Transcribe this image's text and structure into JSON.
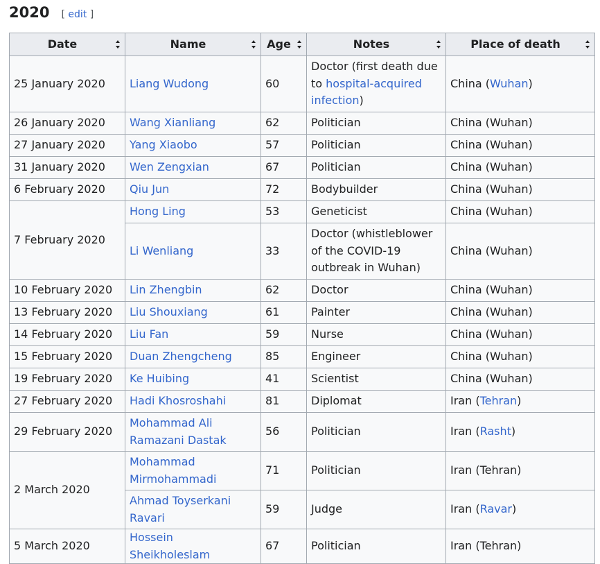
{
  "section": {
    "title": "2020",
    "edit_open": "[ ",
    "edit_label": "edit",
    "edit_close": " ]"
  },
  "table": {
    "headers": [
      "Date",
      "Name",
      "Age",
      "Notes",
      "Place of death"
    ],
    "rows": [
      {
        "date": "25 January 2020",
        "name": "Liang Wudong",
        "age": "60",
        "notes": [
          "Doctor (first death due to ",
          {
            "link": "hospital-acquired infection"
          },
          ")"
        ],
        "place": [
          "China (",
          {
            "link": "Wuhan"
          },
          ")"
        ],
        "h": 3
      },
      {
        "date": "26 January 2020",
        "name": "Wang Xianliang",
        "age": "62",
        "notes": [
          "Politician"
        ],
        "place": [
          "China (Wuhan)"
        ],
        "h": 1
      },
      {
        "date": "27 January 2020",
        "name": "Yang Xiaobo",
        "age": "57",
        "notes": [
          "Politician"
        ],
        "place": [
          "China (Wuhan)"
        ],
        "h": 1
      },
      {
        "date": "31 January 2020",
        "name": "Wen Zengxian",
        "age": "67",
        "notes": [
          "Politician"
        ],
        "place": [
          "China (Wuhan)"
        ],
        "h": 1
      },
      {
        "date": "6 February 2020",
        "name": "Qiu Jun",
        "age": "72",
        "notes": [
          "Bodybuilder"
        ],
        "place": [
          "China (Wuhan)"
        ],
        "h": 1
      },
      {
        "date": "7 February 2020",
        "span": 2,
        "name": "Hong Ling",
        "age": "53",
        "notes": [
          "Geneticist"
        ],
        "place": [
          "China (Wuhan)"
        ],
        "h": 1
      },
      {
        "name": "Li Wenliang",
        "age": "33",
        "notes": [
          "Doctor (whistleblower of the COVID-19 outbreak in Wuhan)"
        ],
        "place": [
          "China (Wuhan)"
        ],
        "h": 3
      },
      {
        "date": "10 February 2020",
        "name": "Lin Zhengbin",
        "age": "62",
        "notes": [
          "Doctor"
        ],
        "place": [
          "China (Wuhan)"
        ],
        "h": 1
      },
      {
        "date": "13 February 2020",
        "name": "Liu Shouxiang",
        "age": "61",
        "notes": [
          "Painter"
        ],
        "place": [
          "China (Wuhan)"
        ],
        "h": 1
      },
      {
        "date": "14 February 2020",
        "name": "Liu Fan",
        "age": "59",
        "notes": [
          "Nurse"
        ],
        "place": [
          "China (Wuhan)"
        ],
        "h": 1
      },
      {
        "date": "15 February 2020",
        "name": "Duan Zhengcheng",
        "age": "85",
        "notes": [
          "Engineer"
        ],
        "place": [
          "China (Wuhan)"
        ],
        "h": 1
      },
      {
        "date": "19 February 2020",
        "name": "Ke Huibing",
        "age": "41",
        "notes": [
          "Scientist"
        ],
        "place": [
          "China (Wuhan)"
        ],
        "h": 1
      },
      {
        "date": "27 February 2020",
        "name": "Hadi Khosroshahi",
        "age": "81",
        "notes": [
          "Diplomat"
        ],
        "place": [
          "Iran (",
          {
            "link": "Tehran"
          },
          ")"
        ],
        "h": 1
      },
      {
        "date": "29 February 2020",
        "name": "Mohammad Ali Ramazani Dastak",
        "age": "56",
        "notes": [
          "Politician"
        ],
        "place": [
          "Iran (",
          {
            "link": "Rasht"
          },
          ")"
        ],
        "h": 2
      },
      {
        "date": "2 March 2020",
        "span": 2,
        "name": "Mohammad Mirmohammadi",
        "age": "71",
        "notes": [
          "Politician"
        ],
        "place": [
          "Iran (Tehran)"
        ],
        "h": 2
      },
      {
        "name": "Ahmad Toyserkani Ravari",
        "age": "59",
        "notes": [
          "Judge"
        ],
        "place": [
          "Iran (",
          {
            "link": "Ravar"
          },
          ")"
        ],
        "h": 2
      },
      {
        "date": "5 March 2020",
        "name": "Hossein Sheikholeslam",
        "age": "67",
        "notes": [
          "Politician"
        ],
        "place": [
          "Iran (Tehran)"
        ],
        "h": 1
      }
    ]
  }
}
